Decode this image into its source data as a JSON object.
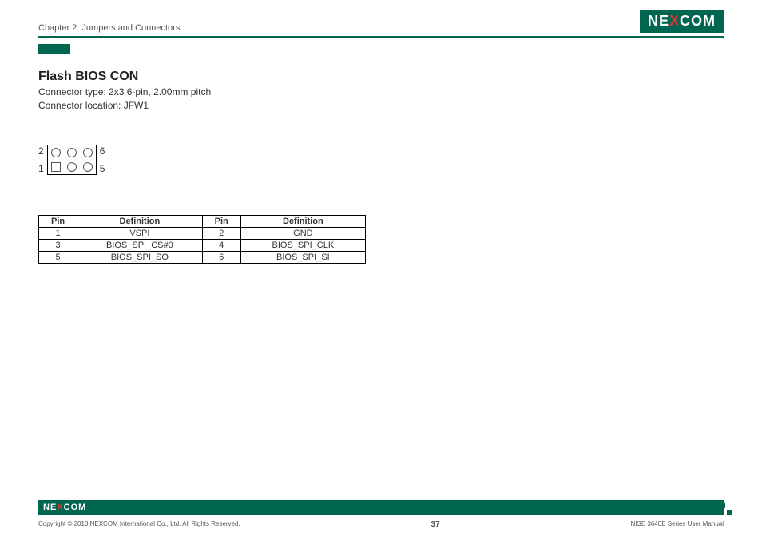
{
  "header": {
    "chapter": "Chapter 2: Jumpers and Connectors",
    "brand_pre": "NE",
    "brand_x": "X",
    "brand_post": "COM"
  },
  "section": {
    "title": "Flash BIOS CON",
    "connector_type": "Connector type: 2x3 6-pin, 2.00mm pitch",
    "connector_location": "Connector location: JFW1"
  },
  "diagram_labels": {
    "top_left": "2",
    "bottom_left": "1",
    "top_right": "6",
    "bottom_right": "5"
  },
  "table": {
    "headers": {
      "pin": "Pin",
      "def": "Definition"
    },
    "rows": [
      {
        "p1": "1",
        "d1": "VSPI",
        "p2": "2",
        "d2": "GND"
      },
      {
        "p1": "3",
        "d1": "BIOS_SPI_CS#0",
        "p2": "4",
        "d2": "BIOS_SPI_CLK"
      },
      {
        "p1": "5",
        "d1": "BIOS_SPI_SO",
        "p2": "6",
        "d2": "BIOS_SPI_SI"
      }
    ]
  },
  "footer": {
    "copyright": "Copyright © 2013 NEXCOM International Co., Ltd. All Rights Reserved.",
    "page": "37",
    "manual": "NISE 3640E Series User Manual"
  }
}
